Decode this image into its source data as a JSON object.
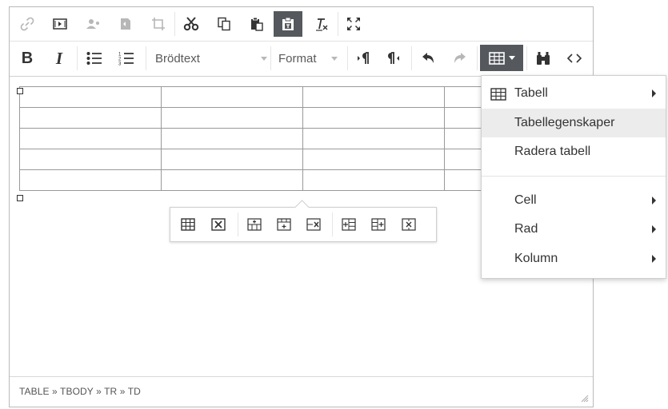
{
  "toolbar": {
    "row1": [
      "link-icon",
      "media-icon",
      "anchor-icon",
      "image-icon",
      "crop-icon",
      "cut-icon",
      "copy-icon",
      "paste-icon",
      "paste-text-icon",
      "remove-format-icon",
      "fullscreen-icon"
    ],
    "row2": {
      "bold": "B",
      "italic": "I",
      "block_format": "Brödtext",
      "format": "Format"
    }
  },
  "table_menu": {
    "items": [
      {
        "label": "Tabell",
        "submenu": true
      },
      {
        "label": "Tabellegenskaper",
        "submenu": false
      },
      {
        "label": "Radera tabell",
        "submenu": false
      },
      {
        "label": "Cell",
        "submenu": true
      },
      {
        "label": "Rad",
        "submenu": true
      },
      {
        "label": "Kolumn",
        "submenu": true
      }
    ]
  },
  "statusbar": {
    "path": "TABLE » TBODY » TR » TD"
  },
  "colors": {
    "active_button": "#55595e",
    "menu_highlight": "#ececec",
    "table_border": "#999999"
  }
}
